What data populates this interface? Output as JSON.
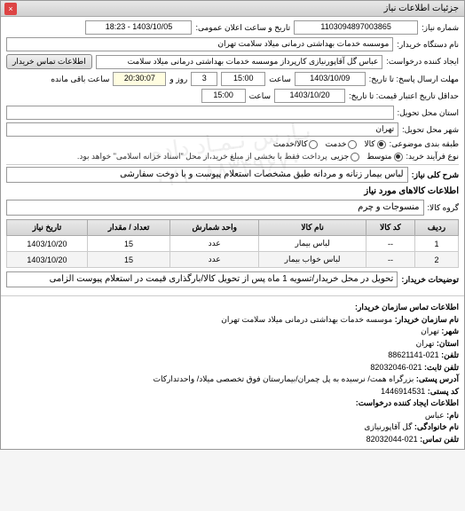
{
  "header": {
    "title": "جزئیات اطلاعات نیاز"
  },
  "info": {
    "req_no_label": "شماره نیاز:",
    "req_no": "1103094897003865",
    "announce_label": "تاریخ و ساعت اعلان عمومی:",
    "announce_value": "1403/10/05 - 18:23",
    "org_label": "نام دستگاه خریدار:",
    "org_value": "موسسه خدمات بهداشتی درمانی میلاد سلامت تهران",
    "requester_label": "ایجاد کننده درخواست:",
    "requester_value": "عباس گل آقاپورنیازی کارپرداز موسسه خدمات بهداشتی درمانی میلاد سلامت",
    "contact_buyer_btn": "اطلاعات تماس خریدار",
    "deadline_reply_label": "مهلت ارسال پاسخ: تا تاریخ:",
    "deadline_reply_date": "1403/10/09",
    "deadline_reply_time_label": "ساعت",
    "deadline_reply_time": "15:00",
    "days_left": "3",
    "days_left_label_after": "روز و",
    "time_left": "20:30:07",
    "time_left_label": "ساعت باقی مانده",
    "validity_label": "حداقل تاریخ اعتبار قیمت: تا تاریخ:",
    "validity_date": "1403/10/20",
    "validity_time_label": "ساعت",
    "validity_time": "15:00",
    "delivery_province_label": "استان محل تحویل:",
    "delivery_city_label": "شهر محل تحویل:",
    "delivery_city_value": "تهران",
    "packaging_label": "طبقه بندی موضوعی:",
    "pkg_goods": "کالا",
    "pkg_service": "خدمت",
    "pkg_both": "کالا/خدمت",
    "process_label": "نوع فرآیند خرید:",
    "proc_mid": "متوسط",
    "proc_part": "جزیی",
    "process_note": "پرداخت فقط با بخشی از مبلغ خرید،از محل \"اسناد خزانه اسلامی\" خواهد بود."
  },
  "desc": {
    "title_label": "شرح کلی نیاز:",
    "title_value": "لباس بیمار زنانه و مردانه طبق مشخصات استعلام پیوست و با دوخت سفارشی",
    "goods_heading": "اطلاعات کالاهای مورد نیاز",
    "group_label": "گروه کالا:",
    "group_value": "منسوجات و چرم"
  },
  "table": {
    "headers": [
      "ردیف",
      "کد کالا",
      "نام کالا",
      "واحد شمارش",
      "تعداد / مقدار",
      "تاریخ نیاز"
    ],
    "rows": [
      {
        "idx": "1",
        "code": "--",
        "name": "لباس بیمار",
        "unit": "عدد",
        "qty": "15",
        "date": "1403/10/20"
      },
      {
        "idx": "2",
        "code": "--",
        "name": "لباس خواب بیمار",
        "unit": "عدد",
        "qty": "15",
        "date": "1403/10/20"
      }
    ]
  },
  "buyer_notes": {
    "label": "توضیحات خریدار:",
    "value": "تحویل در محل خریدار/تسویه 1 ماه پس از تحویل کالا/بارگذاری قیمت در استعلام پیوست الزامی"
  },
  "contact": {
    "heading": "اطلاعات تماس سازمان خریدار:",
    "org_name_label": "نام سازمان خریدار:",
    "org_name": "موسسه خدمات بهداشتی درمانی میلاد سلامت تهران",
    "city_label": "شهر:",
    "city": "تهران",
    "province_label": "استان:",
    "province": "تهران",
    "phone_label": "تلفن:",
    "phone": "021-88621141",
    "fax_label": "تلفن ثابت:",
    "fax": "021-82032046",
    "postal_addr_label": "آدرس پستی:",
    "postal_addr": "بزرگراه همت/ نرسیده به پل چمران/بیمارستان فوق تخصصی میلاد/ واحدتدارکات",
    "postal_code_label": "کد پستی:",
    "postal_code": "1446914531",
    "creator_heading": "اطلاعات ایجاد کننده درخواست:",
    "fname_label": "نام:",
    "fname": "عباس",
    "lname_label": "نام خانوادگی:",
    "lname": "گل آقاپورنیازی",
    "creator_phone_label": "تلفن تماس:",
    "creator_phone": "021-82032044"
  },
  "watermark": {
    "line1": "پـارس نـمـاد داده",
    "line2": "۰۲۱–۸۸۳۴۹۶۷۰"
  }
}
